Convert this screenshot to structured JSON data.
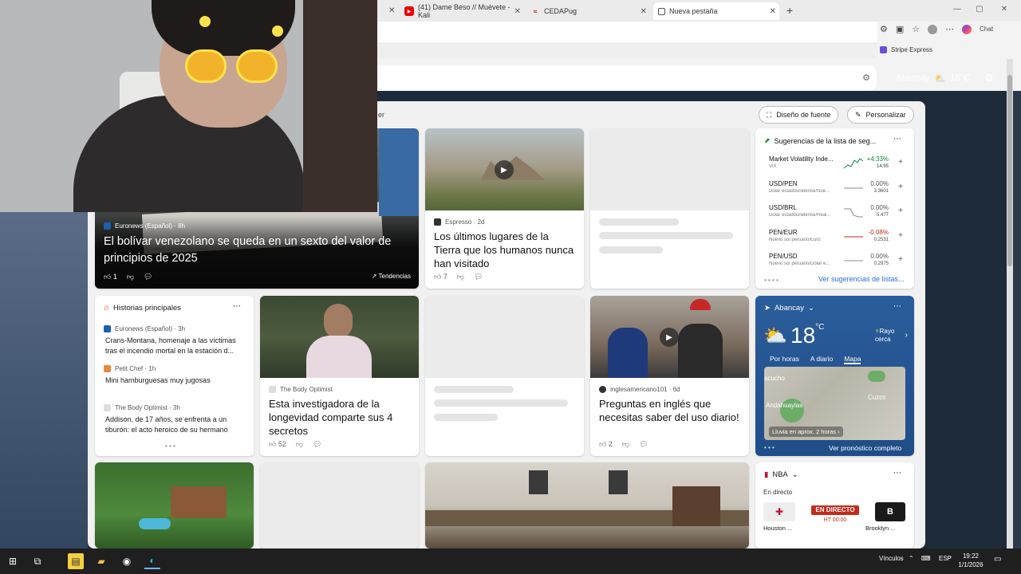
{
  "browser": {
    "tabs": [
      {
        "title": "(41) Dame Beso // Muévete - Kali",
        "icon": "youtube-icon"
      },
      {
        "title": "CEDAPug",
        "icon": "cedapug-icon"
      },
      {
        "title": "Nueva pestaña",
        "icon": "newtab-icon"
      }
    ],
    "toolbar_chat": "Chat",
    "favorites_item": "Stripe Express"
  },
  "header": {
    "location": "Abancay",
    "temp": "18°C",
    "partial_link": "er"
  },
  "pills": {
    "font_design": "Diseño de fuente",
    "personalize": "Personalizar"
  },
  "featured": {
    "source": "Euronews (Español) · 8h",
    "title": "El bolívar venezolano se queda en un sexto del valor de principios de 2025",
    "likes": "1",
    "trending": "Tendencias"
  },
  "card_espresso": {
    "source": "Espresso · 2d",
    "title": "Los últimos lugares de la Tierra que los humanos nunca han visitado",
    "likes": "7"
  },
  "markets": {
    "title": "Sugerencias de la lista de seg...",
    "rows": [
      {
        "sym": "Market Volatility Inde...",
        "desc": "VIX",
        "chg": "+4.33%",
        "val": "14.95",
        "color": "#0e8a3a"
      },
      {
        "sym": "USD/PEN",
        "desc": "Dólar estadounidense/Nue...",
        "chg": "0.00%",
        "val": "3.3601",
        "color": "#555555"
      },
      {
        "sym": "USD/BRL",
        "desc": "Dólar estadounidense/Real...",
        "chg": "0.00%",
        "val": "5.477",
        "color": "#555555"
      },
      {
        "sym": "PEN/EUR",
        "desc": "Nuevo sol peruano/Euro",
        "chg": "-0.08%",
        "val": "0.2531",
        "color": "#c42b1c"
      },
      {
        "sym": "PEN/USD",
        "desc": "Nuevo sol peruano/Dólar e...",
        "chg": "0.00%",
        "val": "0.2975",
        "color": "#555555"
      }
    ],
    "link": "Ver sugerencias de listas..."
  },
  "top_stories": {
    "title": "Historias principales",
    "items": [
      {
        "source": "Euronews (Español) · 3h",
        "text": "Crans-Montana, homenaje a las víctimas tras el incendio mortal en la estación d..."
      },
      {
        "source": "Petit Chef · 1h",
        "text": "Mini hamburguesas muy jugosas"
      },
      {
        "source": "The Body Optimist · 3h",
        "text": "Addison, de 17 años, se enfrenta a un tiburón: el acto heroico de su hermano"
      }
    ]
  },
  "card_longevity": {
    "source": "The Body Optimist",
    "title": "Esta investigadora de la longevidad comparte sus 4 secretos",
    "likes": "52"
  },
  "card_english": {
    "source": "inglesamericano101 · 6d",
    "title": "Preguntas en inglés que necesitas saber del uso diario!",
    "likes": "2"
  },
  "weather": {
    "location": "Abancay",
    "temp": "18",
    "unit": "°C",
    "alert": "Rayo cerca",
    "tabs": [
      "Por horas",
      "A diario",
      "Mapa"
    ],
    "map_labels": [
      "acucho",
      "Andahuaylas",
      "Cuzco"
    ],
    "rain": "Lluvia en aprox. 2 horas",
    "link": "Ver pronóstico completo"
  },
  "nba": {
    "title": "NBA",
    "live": "En directo",
    "home": "Houston ...",
    "away": "Brooklyn ...",
    "status": "EN DIRECTO",
    "time": "HT 00:00"
  },
  "taskbar": {
    "links": "Vínculos",
    "lang": "ESP",
    "time": "19:22",
    "date": "1/1/2026"
  }
}
